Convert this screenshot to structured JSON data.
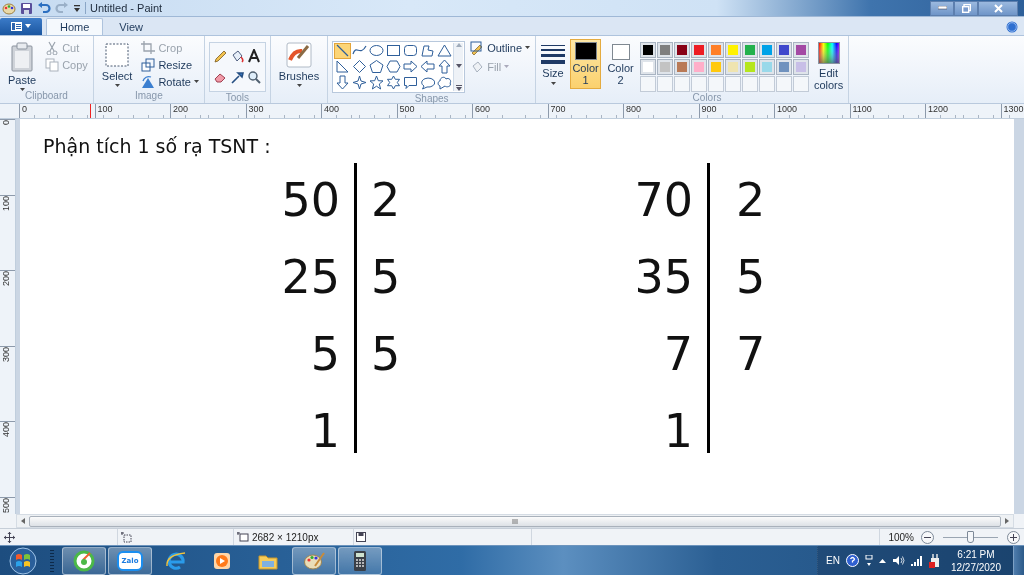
{
  "window": {
    "title": "Untitled - Paint"
  },
  "tabs": [
    {
      "label": "Home",
      "selected": true
    },
    {
      "label": "View",
      "selected": false
    }
  ],
  "ribbon": {
    "clipboard": {
      "group_label": "Clipboard",
      "buttons": [
        {
          "label": "Paste",
          "kind": "large",
          "disabled": false
        },
        {
          "label": "Cut",
          "kind": "small",
          "disabled": true
        },
        {
          "label": "Copy",
          "kind": "small",
          "disabled": true
        }
      ]
    },
    "image": {
      "group_label": "Image",
      "buttons": [
        {
          "label": "Select",
          "kind": "large",
          "disabled": false
        },
        {
          "label": "Crop",
          "kind": "small",
          "disabled": true
        },
        {
          "label": "Resize",
          "kind": "small",
          "disabled": false
        },
        {
          "label": "Rotate",
          "kind": "small",
          "disabled": false
        }
      ]
    },
    "tools": {
      "group_label": "Tools"
    },
    "brushes": {
      "label": "Brushes"
    },
    "shapes": {
      "group_label": "Shapes",
      "items": [
        {
          "kind": "line",
          "selected": true
        },
        {
          "kind": "curve",
          "selected": false
        },
        {
          "kind": "oval",
          "selected": false
        },
        {
          "kind": "rect",
          "selected": false
        },
        {
          "kind": "roundrect",
          "selected": false
        },
        {
          "kind": "polygon",
          "selected": false
        },
        {
          "kind": "triangle",
          "selected": false
        },
        {
          "kind": "right-triangle",
          "selected": false
        },
        {
          "kind": "diamond",
          "selected": false
        },
        {
          "kind": "pentagon",
          "selected": false
        },
        {
          "kind": "hexagon",
          "selected": false
        },
        {
          "kind": "arrow-right",
          "selected": false
        },
        {
          "kind": "arrow-left",
          "selected": false
        },
        {
          "kind": "arrow-up",
          "selected": false
        },
        {
          "kind": "arrow-down",
          "selected": false
        },
        {
          "kind": "star4",
          "selected": false
        },
        {
          "kind": "star5",
          "selected": false
        },
        {
          "kind": "star6",
          "selected": false
        },
        {
          "kind": "callout-rect",
          "selected": false
        },
        {
          "kind": "callout-oval",
          "selected": false
        },
        {
          "kind": "callout-cloud",
          "selected": false
        }
      ],
      "outline": {
        "label": "Outline",
        "disabled": false
      },
      "fill": {
        "label": "Fill",
        "disabled": true
      }
    },
    "size": {
      "label": "Size"
    },
    "color1": {
      "label": "Color 1",
      "color": "#000000",
      "selected": true
    },
    "color2": {
      "label": "Color 2",
      "color": "#ffffff",
      "selected": false
    },
    "colors": {
      "group_label": "Colors",
      "swatches": [
        {
          "color": "#000000"
        },
        {
          "color": "#7f7f7f"
        },
        {
          "color": "#880015"
        },
        {
          "color": "#ed1c24"
        },
        {
          "color": "#ff7f27"
        },
        {
          "color": "#fff200"
        },
        {
          "color": "#22b14c"
        },
        {
          "color": "#00a2e8"
        },
        {
          "color": "#3f48cc"
        },
        {
          "color": "#a349a4"
        },
        {
          "color": "#ffffff"
        },
        {
          "color": "#c3c3c3"
        },
        {
          "color": "#b97a57"
        },
        {
          "color": "#ffaec9"
        },
        {
          "color": "#ffc90e"
        },
        {
          "color": "#efe4b0"
        },
        {
          "color": "#b5e61d"
        },
        {
          "color": "#99d9ea"
        },
        {
          "color": "#7092be"
        },
        {
          "color": "#c8bfe7"
        }
      ]
    },
    "edit_colors": {
      "label": "Edit colors"
    }
  },
  "ruler": {
    "marks": [
      "0",
      "100",
      "200",
      "300",
      "400",
      "500",
      "600",
      "700",
      "800",
      "900",
      "1000",
      "1100",
      "1200",
      "1300"
    ]
  },
  "vertical_ruler": {
    "marks": [
      "0",
      "100",
      "200",
      "300",
      "400",
      "500"
    ]
  },
  "canvas": {
    "heading": "Phận tích 1 số rạ TSNT :",
    "tables": [
      {
        "rows": [
          {
            "number": "50",
            "factor": "2"
          },
          {
            "number": "25",
            "factor": "5"
          },
          {
            "number": "5",
            "factor": "5"
          },
          {
            "number": "1"
          }
        ]
      },
      {
        "rows": [
          {
            "number": "70",
            "factor": "2"
          },
          {
            "number": "35",
            "factor": "5"
          },
          {
            "number": "7",
            "factor": "7"
          },
          {
            "number": "1"
          }
        ]
      }
    ]
  },
  "status_bar": {
    "dimensions": "2682 × 1210px",
    "zoom": "100%",
    "zoom_slider": {
      "level": 0.5
    }
  },
  "taskbar": {
    "apps": [
      {
        "kind": "browser-leaf",
        "running": true
      },
      {
        "kind": "chat",
        "label": "Zalo",
        "running": true
      },
      {
        "kind": "browser-e",
        "running": false
      },
      {
        "kind": "media",
        "running": false
      },
      {
        "kind": "folder",
        "running": false
      },
      {
        "kind": "paint",
        "running": true
      },
      {
        "kind": "calculator",
        "running": true
      }
    ],
    "tray": {
      "language": "EN",
      "time": "6:21 PM",
      "date": "12/27/2020"
    }
  }
}
